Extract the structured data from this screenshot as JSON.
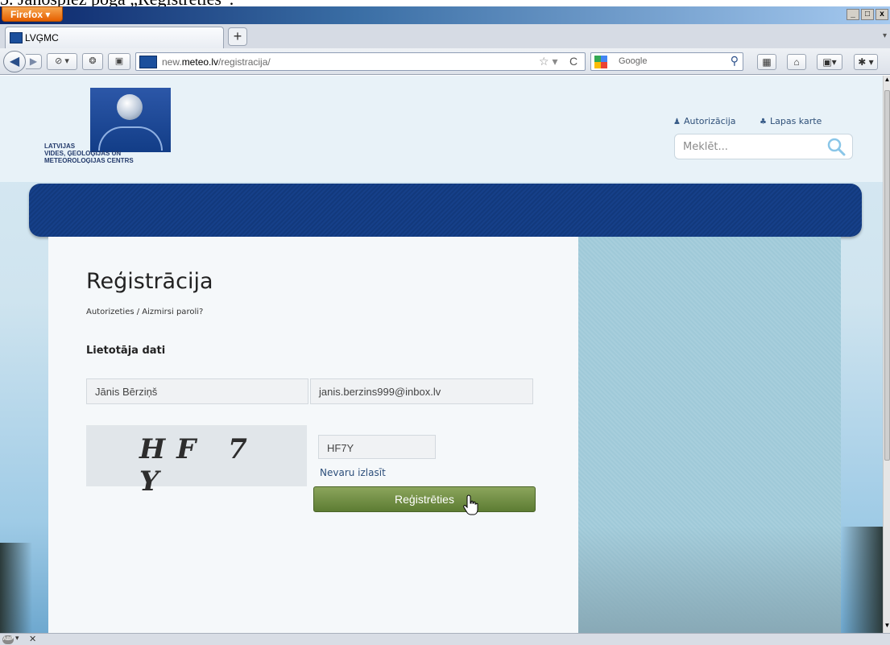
{
  "caption": "3. Jānospiež poga „Reģistrēties”.",
  "browser": {
    "menu_button": "Firefox",
    "window_controls": [
      "_",
      "□",
      "x"
    ],
    "tab": {
      "title": "LVĢMC"
    },
    "new_tab": "+",
    "url": {
      "prefix": "new.",
      "domain": "meteo.lv",
      "path": "/registracija/"
    },
    "search_engine": "Google",
    "icons": [
      "back-icon",
      "forward-icon",
      "history-icon",
      "addon-icon",
      "star-icon",
      "reload-icon",
      "search-icon",
      "grid-icon",
      "home-icon",
      "bookmark-icon",
      "puzzle-icon"
    ]
  },
  "site": {
    "logo_text": [
      "LATVIJAS",
      "VIDES, ĢEOLOĢIJAS UN",
      "METEOROLOĢIJAS CENTRS"
    ],
    "toplinks": [
      {
        "label": "Autorizācija",
        "icon": "user-icon"
      },
      {
        "label": "Lapas karte",
        "icon": "sitemap-icon"
      }
    ],
    "search_placeholder": "Meklēt..."
  },
  "form": {
    "title": "Reģistrācija",
    "sublinks": "Autorizeties / Aizmirsi paroli?",
    "section": "Lietotāja dati",
    "name_value": "Jānis Bērziņš",
    "email_value": "janis.berzins999@inbox.lv",
    "captcha_image": "HF 7 Y",
    "captcha_value": "HF7Y",
    "cant_read": "Nevaru izlasīt",
    "submit": "Reģistrēties"
  },
  "colors": {
    "nav_band": "#12397d",
    "submit": "#6b8a3f",
    "link": "#2c4e7a"
  }
}
